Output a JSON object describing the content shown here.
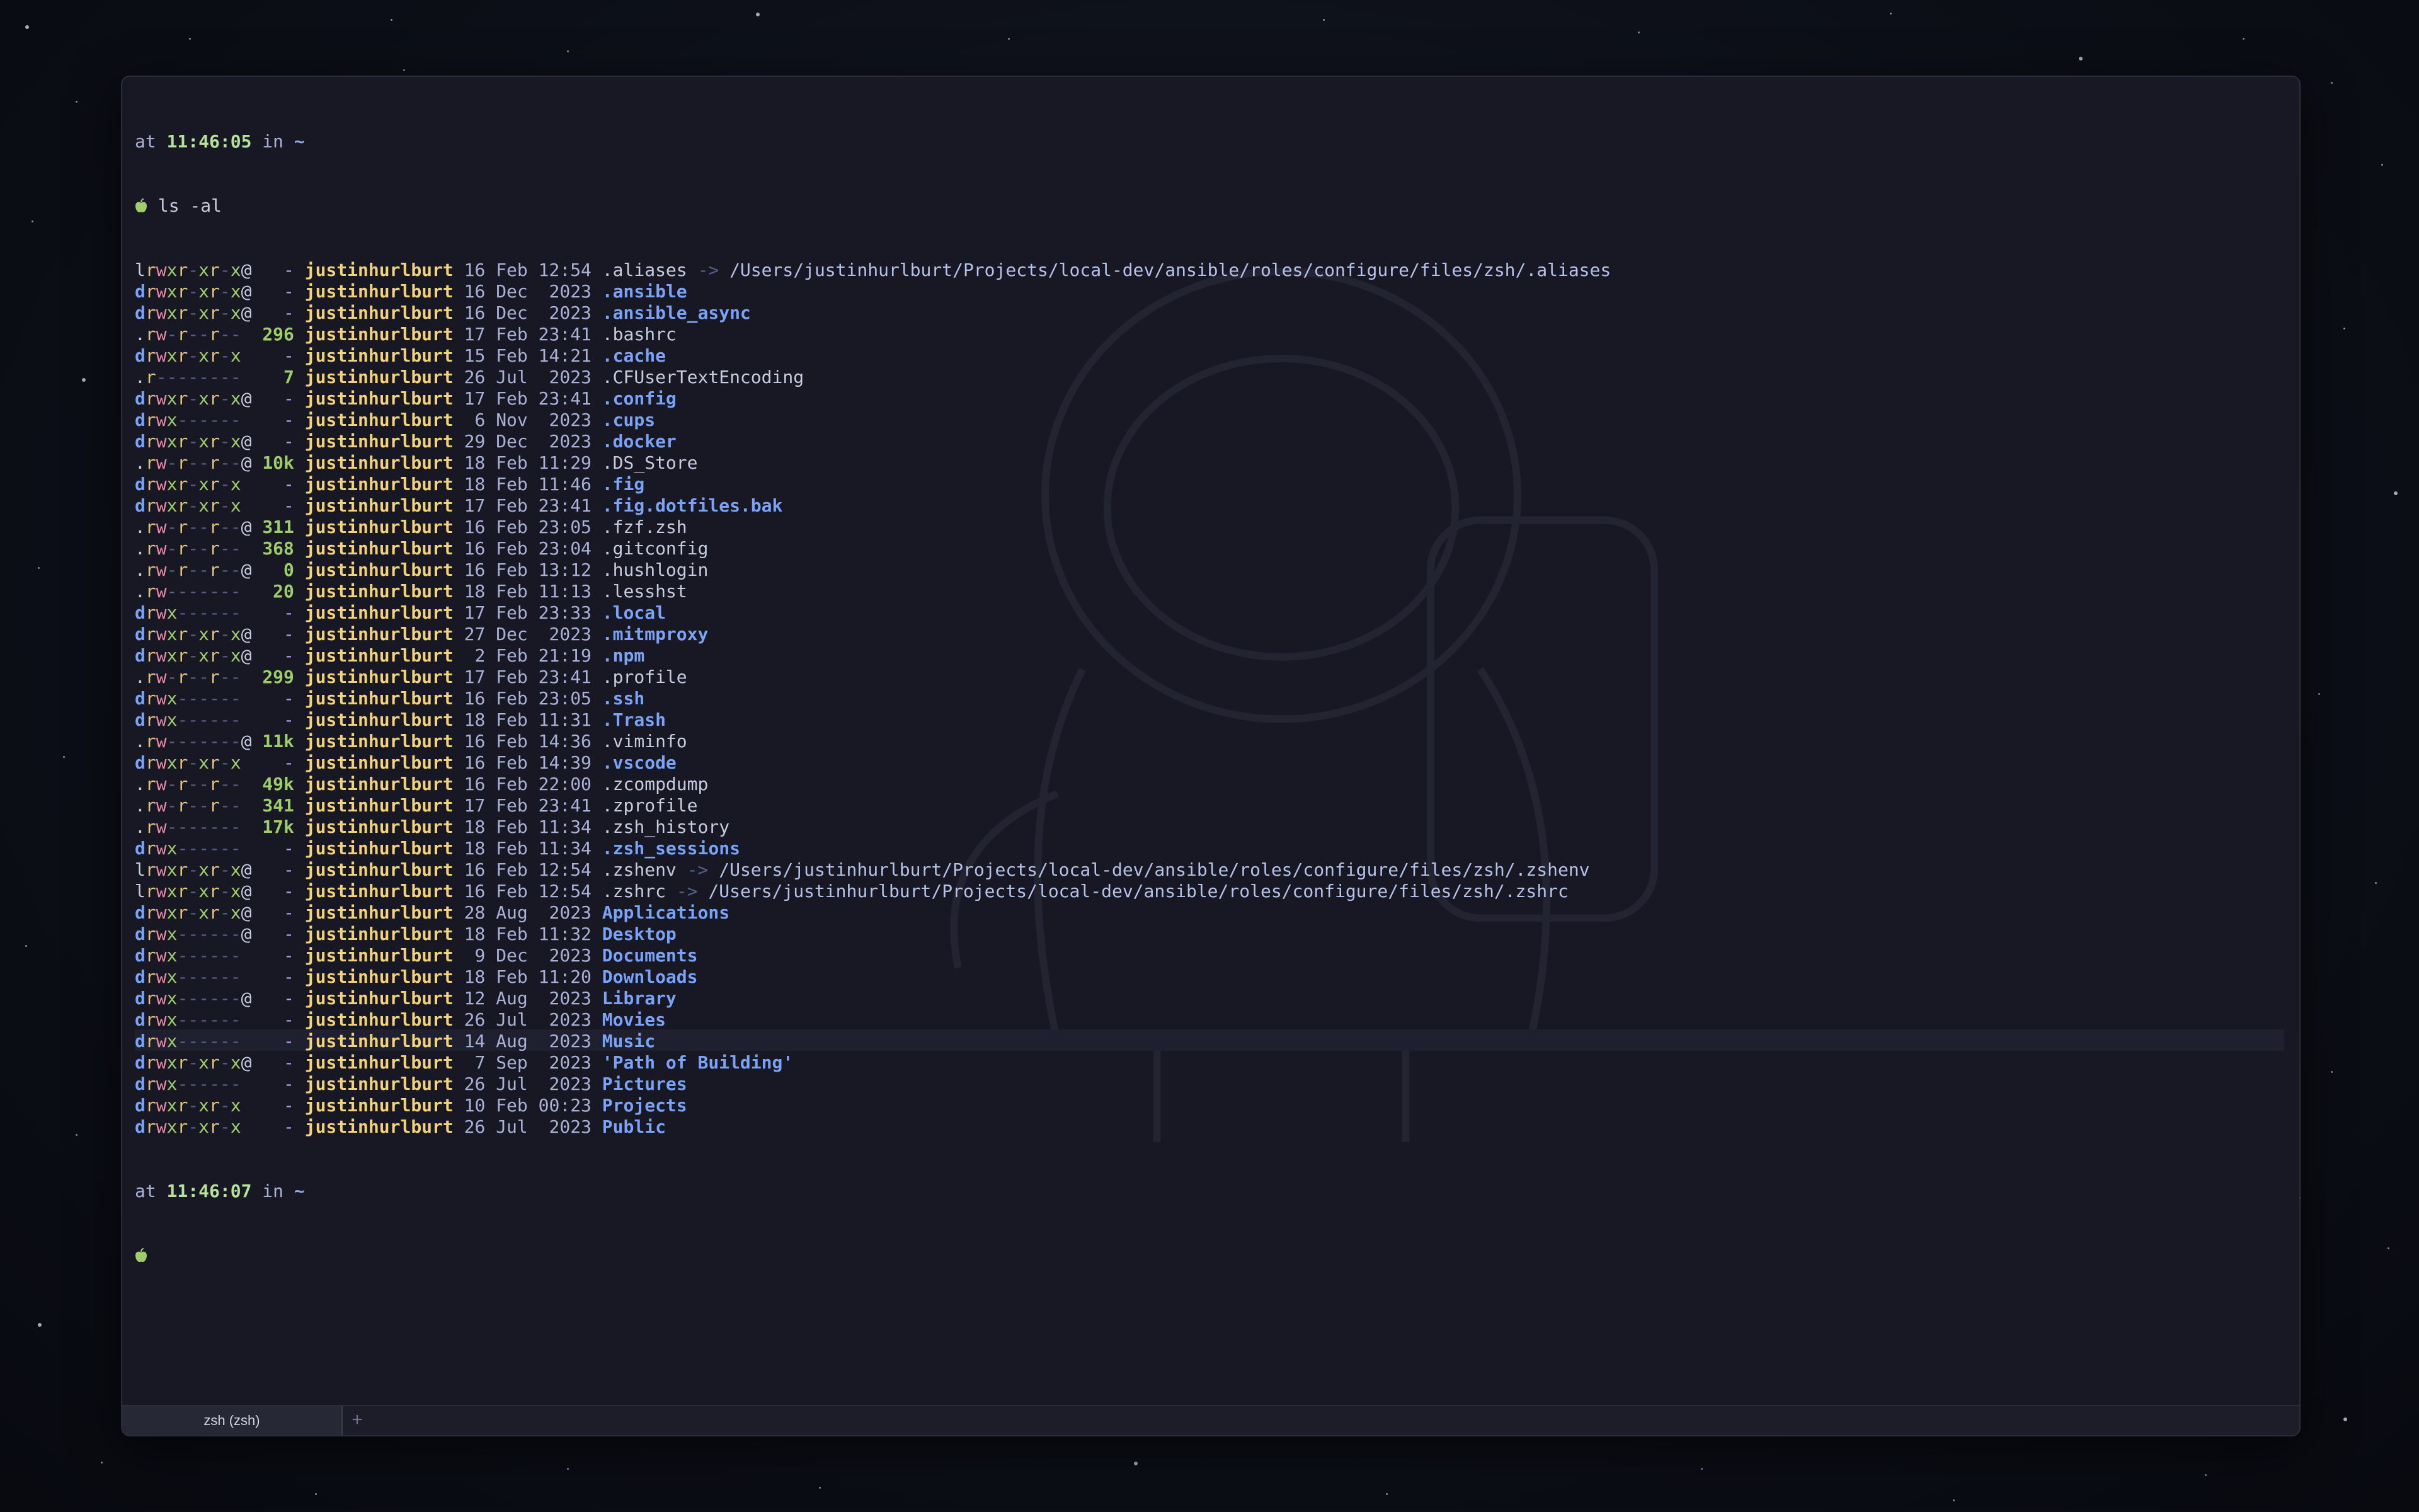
{
  "prompt_top": {
    "at": "at",
    "time": "11:46:05",
    "in": "in",
    "dir": "~"
  },
  "command": "ls -al",
  "prompt_bottom": {
    "at": "at",
    "time": "11:46:07",
    "in": "in",
    "dir": "~"
  },
  "listing": [
    {
      "perm": "lrwxr-xr-x@",
      "size": "-",
      "user": "justinhurlburt",
      "day": "16",
      "mon": "Feb",
      "tm": "12:54",
      "name": ".aliases",
      "dir": false,
      "link": "/Users/justinhurlburt/Projects/local-dev/ansible/roles/configure/files/zsh/.aliases"
    },
    {
      "perm": "drwxr-xr-x@",
      "size": "-",
      "user": "justinhurlburt",
      "day": "16",
      "mon": "Dec",
      "tm": " 2023",
      "name": ".ansible",
      "dir": true
    },
    {
      "perm": "drwxr-xr-x@",
      "size": "-",
      "user": "justinhurlburt",
      "day": "16",
      "mon": "Dec",
      "tm": " 2023",
      "name": ".ansible_async",
      "dir": true
    },
    {
      "perm": ".rw-r--r--",
      "size": "296",
      "user": "justinhurlburt",
      "day": "17",
      "mon": "Feb",
      "tm": "23:41",
      "name": ".bashrc",
      "dir": false
    },
    {
      "perm": "drwxr-xr-x",
      "size": "-",
      "user": "justinhurlburt",
      "day": "15",
      "mon": "Feb",
      "tm": "14:21",
      "name": ".cache",
      "dir": true
    },
    {
      "perm": ".r--------",
      "size": "7",
      "user": "justinhurlburt",
      "day": "26",
      "mon": "Jul",
      "tm": " 2023",
      "name": ".CFUserTextEncoding",
      "dir": false
    },
    {
      "perm": "drwxr-xr-x@",
      "size": "-",
      "user": "justinhurlburt",
      "day": "17",
      "mon": "Feb",
      "tm": "23:41",
      "name": ".config",
      "dir": true
    },
    {
      "perm": "drwx------",
      "size": "-",
      "user": "justinhurlburt",
      "day": " 6",
      "mon": "Nov",
      "tm": " 2023",
      "name": ".cups",
      "dir": true
    },
    {
      "perm": "drwxr-xr-x@",
      "size": "-",
      "user": "justinhurlburt",
      "day": "29",
      "mon": "Dec",
      "tm": " 2023",
      "name": ".docker",
      "dir": true
    },
    {
      "perm": ".rw-r--r--@",
      "size": "10k",
      "user": "justinhurlburt",
      "day": "18",
      "mon": "Feb",
      "tm": "11:29",
      "name": ".DS_Store",
      "dir": false
    },
    {
      "perm": "drwxr-xr-x",
      "size": "-",
      "user": "justinhurlburt",
      "day": "18",
      "mon": "Feb",
      "tm": "11:46",
      "name": ".fig",
      "dir": true
    },
    {
      "perm": "drwxr-xr-x",
      "size": "-",
      "user": "justinhurlburt",
      "day": "17",
      "mon": "Feb",
      "tm": "23:41",
      "name": ".fig.dotfiles.bak",
      "dir": true
    },
    {
      "perm": ".rw-r--r--@",
      "size": "311",
      "user": "justinhurlburt",
      "day": "16",
      "mon": "Feb",
      "tm": "23:05",
      "name": ".fzf.zsh",
      "dir": false
    },
    {
      "perm": ".rw-r--r--",
      "size": "368",
      "user": "justinhurlburt",
      "day": "16",
      "mon": "Feb",
      "tm": "23:04",
      "name": ".gitconfig",
      "dir": false
    },
    {
      "perm": ".rw-r--r--@",
      "size": "0",
      "user": "justinhurlburt",
      "day": "16",
      "mon": "Feb",
      "tm": "13:12",
      "name": ".hushlogin",
      "dir": false
    },
    {
      "perm": ".rw-------",
      "size": "20",
      "user": "justinhurlburt",
      "day": "18",
      "mon": "Feb",
      "tm": "11:13",
      "name": ".lesshst",
      "dir": false
    },
    {
      "perm": "drwx------",
      "size": "-",
      "user": "justinhurlburt",
      "day": "17",
      "mon": "Feb",
      "tm": "23:33",
      "name": ".local",
      "dir": true
    },
    {
      "perm": "drwxr-xr-x@",
      "size": "-",
      "user": "justinhurlburt",
      "day": "27",
      "mon": "Dec",
      "tm": " 2023",
      "name": ".mitmproxy",
      "dir": true
    },
    {
      "perm": "drwxr-xr-x@",
      "size": "-",
      "user": "justinhurlburt",
      "day": " 2",
      "mon": "Feb",
      "tm": "21:19",
      "name": ".npm",
      "dir": true
    },
    {
      "perm": ".rw-r--r--",
      "size": "299",
      "user": "justinhurlburt",
      "day": "17",
      "mon": "Feb",
      "tm": "23:41",
      "name": ".profile",
      "dir": false
    },
    {
      "perm": "drwx------",
      "size": "-",
      "user": "justinhurlburt",
      "day": "16",
      "mon": "Feb",
      "tm": "23:05",
      "name": ".ssh",
      "dir": true
    },
    {
      "perm": "drwx------",
      "size": "-",
      "user": "justinhurlburt",
      "day": "18",
      "mon": "Feb",
      "tm": "11:31",
      "name": ".Trash",
      "dir": true
    },
    {
      "perm": ".rw-------@",
      "size": "11k",
      "user": "justinhurlburt",
      "day": "16",
      "mon": "Feb",
      "tm": "14:36",
      "name": ".viminfo",
      "dir": false
    },
    {
      "perm": "drwxr-xr-x",
      "size": "-",
      "user": "justinhurlburt",
      "day": "16",
      "mon": "Feb",
      "tm": "14:39",
      "name": ".vscode",
      "dir": true
    },
    {
      "perm": ".rw-r--r--",
      "size": "49k",
      "user": "justinhurlburt",
      "day": "16",
      "mon": "Feb",
      "tm": "22:00",
      "name": ".zcompdump",
      "dir": false
    },
    {
      "perm": ".rw-r--r--",
      "size": "341",
      "user": "justinhurlburt",
      "day": "17",
      "mon": "Feb",
      "tm": "23:41",
      "name": ".zprofile",
      "dir": false
    },
    {
      "perm": ".rw-------",
      "size": "17k",
      "user": "justinhurlburt",
      "day": "18",
      "mon": "Feb",
      "tm": "11:34",
      "name": ".zsh_history",
      "dir": false
    },
    {
      "perm": "drwx------",
      "size": "-",
      "user": "justinhurlburt",
      "day": "18",
      "mon": "Feb",
      "tm": "11:34",
      "name": ".zsh_sessions",
      "dir": true
    },
    {
      "perm": "lrwxr-xr-x@",
      "size": "-",
      "user": "justinhurlburt",
      "day": "16",
      "mon": "Feb",
      "tm": "12:54",
      "name": ".zshenv",
      "dir": false,
      "link": "/Users/justinhurlburt/Projects/local-dev/ansible/roles/configure/files/zsh/.zshenv"
    },
    {
      "perm": "lrwxr-xr-x@",
      "size": "-",
      "user": "justinhurlburt",
      "day": "16",
      "mon": "Feb",
      "tm": "12:54",
      "name": ".zshrc",
      "dir": false,
      "link": "/Users/justinhurlburt/Projects/local-dev/ansible/roles/configure/files/zsh/.zshrc"
    },
    {
      "perm": "drwxr-xr-x@",
      "size": "-",
      "user": "justinhurlburt",
      "day": "28",
      "mon": "Aug",
      "tm": " 2023",
      "name": "Applications",
      "dir": true
    },
    {
      "perm": "drwx------@",
      "size": "-",
      "user": "justinhurlburt",
      "day": "18",
      "mon": "Feb",
      "tm": "11:32",
      "name": "Desktop",
      "dir": true
    },
    {
      "perm": "drwx------",
      "size": "-",
      "user": "justinhurlburt",
      "day": " 9",
      "mon": "Dec",
      "tm": " 2023",
      "name": "Documents",
      "dir": true
    },
    {
      "perm": "drwx------",
      "size": "-",
      "user": "justinhurlburt",
      "day": "18",
      "mon": "Feb",
      "tm": "11:20",
      "name": "Downloads",
      "dir": true
    },
    {
      "perm": "drwx------@",
      "size": "-",
      "user": "justinhurlburt",
      "day": "12",
      "mon": "Aug",
      "tm": " 2023",
      "name": "Library",
      "dir": true
    },
    {
      "perm": "drwx------",
      "size": "-",
      "user": "justinhurlburt",
      "day": "26",
      "mon": "Jul",
      "tm": " 2023",
      "name": "Movies",
      "dir": true
    },
    {
      "perm": "drwx------",
      "size": "-",
      "user": "justinhurlburt",
      "day": "14",
      "mon": "Aug",
      "tm": " 2023",
      "name": "Music",
      "dir": true
    },
    {
      "perm": "drwxr-xr-x@",
      "size": "-",
      "user": "justinhurlburt",
      "day": " 7",
      "mon": "Sep",
      "tm": " 2023",
      "name": "'Path of Building'",
      "dir": true
    },
    {
      "perm": "drwx------",
      "size": "-",
      "user": "justinhurlburt",
      "day": "26",
      "mon": "Jul",
      "tm": " 2023",
      "name": "Pictures",
      "dir": true
    },
    {
      "perm": "drwxr-xr-x",
      "size": "-",
      "user": "justinhurlburt",
      "day": "10",
      "mon": "Feb",
      "tm": "00:23",
      "name": "Projects",
      "dir": true
    },
    {
      "perm": "drwxr-xr-x",
      "size": "-",
      "user": "justinhurlburt",
      "day": "26",
      "mon": "Jul",
      "tm": " 2023",
      "name": "Public",
      "dir": true
    }
  ],
  "symlink_arrow": "->",
  "tab": {
    "label": "zsh (zsh)",
    "add": "+"
  },
  "icons": {
    "prompt": "apple-icon",
    "tab_add": "plus-icon"
  },
  "colors": {
    "directory": "#7aa2f7",
    "user": "#f2d27a",
    "size": "#9ece6a",
    "time": "#b6e39c",
    "background": "#171824"
  }
}
